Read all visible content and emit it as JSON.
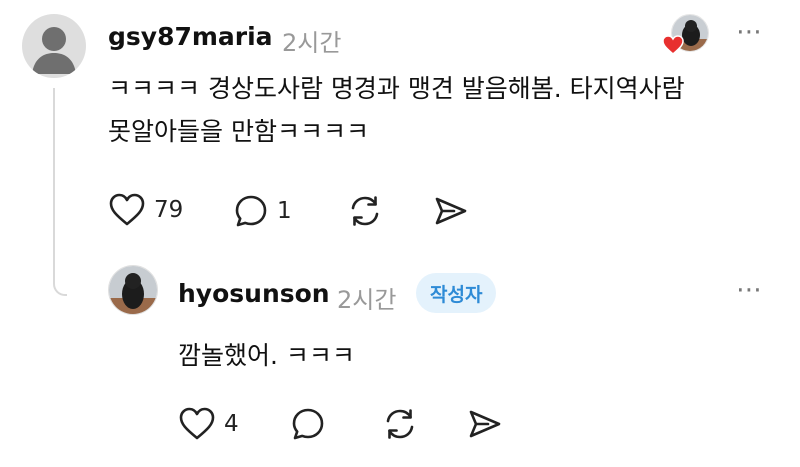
{
  "comment": {
    "username": "gsy87maria",
    "time": "2시간",
    "text_line1": "ㅋㅋㅋㅋ 경상도사람 명경과 맹견 발음해봄. 타지역사람",
    "text_line2": "못알아들을 만함ㅋㅋㅋㅋ",
    "likes": "79",
    "replies": "1",
    "avatar_icon": "default-user-avatar",
    "liked_by_author_icon": "heart-icon"
  },
  "reply": {
    "username": "hyosunson",
    "time": "2시간",
    "badge": "작성자",
    "text": "깜놀했어. ㅋㅋㅋ",
    "likes": "4"
  },
  "more_icon": "⋯",
  "colors": {
    "badge_bg": "#e4f2fc",
    "badge_text": "#2e8bd6",
    "heart": "#e8302f",
    "muted": "#999999"
  }
}
